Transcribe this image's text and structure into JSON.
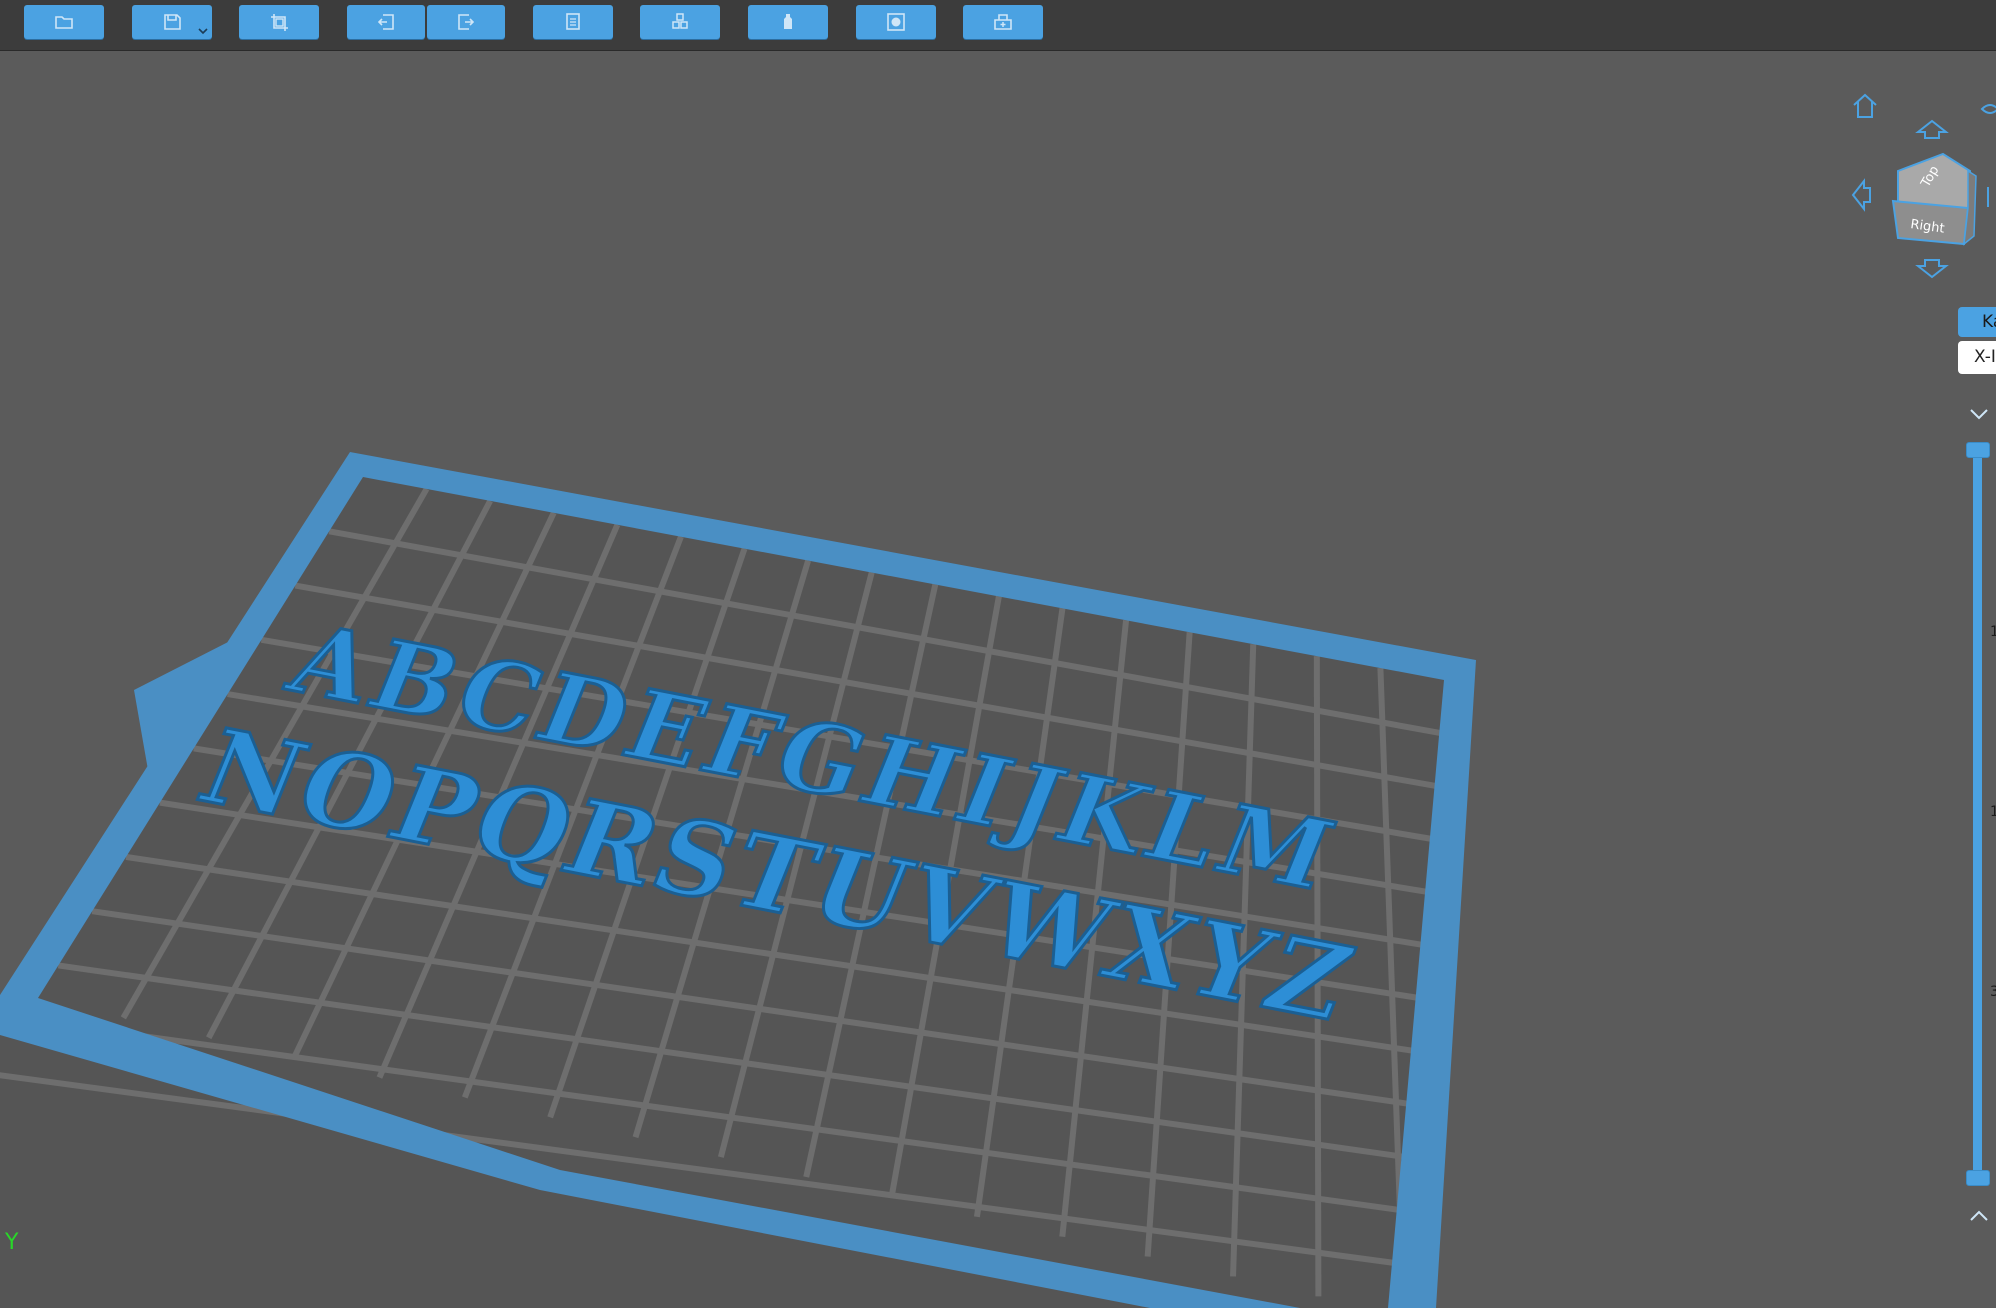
{
  "toolbar": {
    "buttons": [
      {
        "name": "open-file-button",
        "icon": "folder-icon"
      },
      {
        "name": "save-button",
        "icon": "save-icon",
        "has_dropdown": true
      },
      {
        "name": "fit-view-button",
        "icon": "frame-icon"
      },
      {
        "name": "undo-button",
        "icon": "undo-icon"
      },
      {
        "name": "redo-button",
        "icon": "redo-icon"
      },
      {
        "name": "copy-button",
        "icon": "copy-icon"
      },
      {
        "name": "arrange-button",
        "icon": "cubes-icon"
      },
      {
        "name": "support-button",
        "icon": "bottle-icon"
      },
      {
        "name": "hollow-button",
        "icon": "square-dot-icon"
      },
      {
        "name": "add-plate-button",
        "icon": "plate-add-icon"
      }
    ]
  },
  "view_cube": {
    "top_label": "Top",
    "right_label": "Right"
  },
  "side_panel": {
    "mode_label": "Ka",
    "axis_label": "X-I",
    "tick_labels": [
      "1",
      "1",
      "3"
    ]
  },
  "axis_indicator": {
    "y_label": "Y"
  },
  "scene": {
    "text_row_1": "ABCDEFGHIJKLM",
    "text_row_2": "NOPQRSTUVWXYZ"
  },
  "colors": {
    "accent": "#4ba2e2",
    "background": "#5b5b5b",
    "toolbar": "#3c3c3c",
    "plate_frame": "#4a8fc4",
    "grid": "#6b6b6b",
    "letters": "#2d8ed6",
    "axis_y": "#29d629"
  }
}
